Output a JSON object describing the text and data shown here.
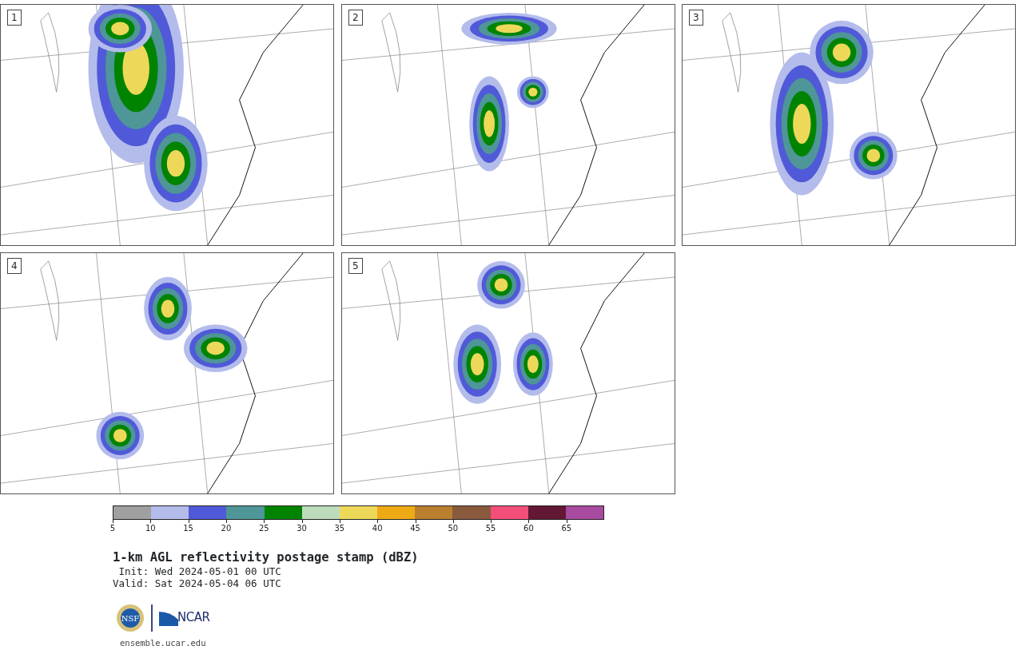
{
  "panels": [
    {
      "label": "1"
    },
    {
      "label": "2"
    },
    {
      "label": "3"
    },
    {
      "label": "4"
    },
    {
      "label": "5"
    }
  ],
  "colorbar": {
    "segments": [
      {
        "color": "#a0a0a0"
      },
      {
        "color": "#b4bcec"
      },
      {
        "color": "#505ad8"
      },
      {
        "color": "#4e9698"
      },
      {
        "color": "#008400"
      },
      {
        "color": "#bcdcbc"
      },
      {
        "color": "#eed85a"
      },
      {
        "color": "#eeaa14"
      },
      {
        "color": "#ba8030"
      },
      {
        "color": "#8a5a3e"
      },
      {
        "color": "#f44e7a"
      },
      {
        "color": "#621834"
      },
      {
        "color": "#a84aa0"
      }
    ],
    "ticks": [
      "5",
      "10",
      "15",
      "20",
      "25",
      "30",
      "35",
      "40",
      "45",
      "50",
      "55",
      "60",
      "65"
    ]
  },
  "title": "1-km AGL reflectivity postage stamp (dBZ)",
  "init": " Init: Wed 2024-05-01 00 UTC",
  "valid": "Valid: Sat 2024-05-04 06 UTC",
  "logos": {
    "agency": "NSF",
    "org": "NCAR"
  },
  "url": "ensemble.ucar.edu"
}
